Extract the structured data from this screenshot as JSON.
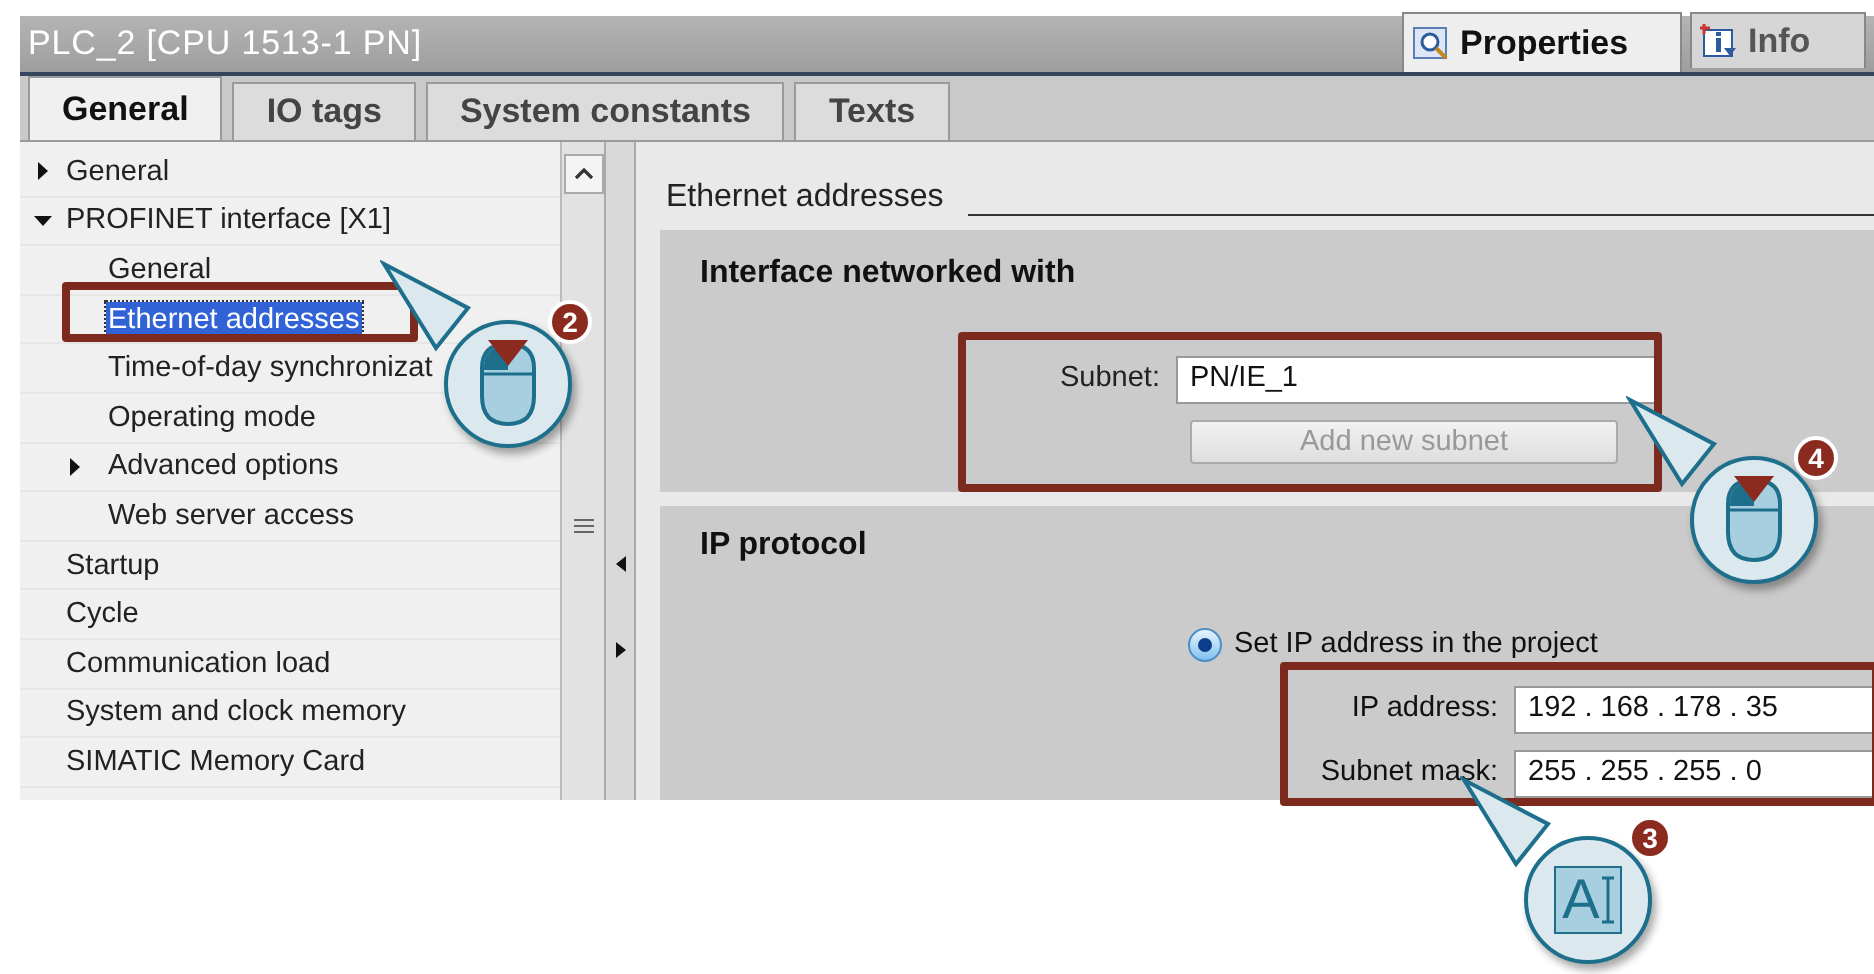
{
  "window": {
    "title": "PLC_2 [CPU 1513-1 PN]"
  },
  "inspector_tabs": [
    {
      "label": "Properties",
      "selected": true,
      "kind": "properties"
    },
    {
      "label": "Info",
      "selected": false,
      "kind": "info"
    }
  ],
  "tabs": [
    {
      "label": "General",
      "selected": true
    },
    {
      "label": "IO tags",
      "selected": false
    },
    {
      "label": "System constants",
      "selected": false
    },
    {
      "label": "Texts",
      "selected": false
    }
  ],
  "tree": [
    {
      "label": "General",
      "expanded": false,
      "selected": false
    },
    {
      "label": "PROFINET interface [X1]",
      "expanded": true,
      "selected": false,
      "children": [
        {
          "label": "General",
          "selected": false
        },
        {
          "label": "Ethernet addresses",
          "selected": true
        },
        {
          "label": "Time-of-day synchronizat",
          "selected": false
        },
        {
          "label": "Operating mode",
          "selected": false
        },
        {
          "label": "Advanced options",
          "expanded": false,
          "selected": false
        },
        {
          "label": "Web server access",
          "selected": false
        }
      ]
    },
    {
      "label": "Startup",
      "selected": false
    },
    {
      "label": "Cycle",
      "selected": false
    },
    {
      "label": "Communication load",
      "selected": false
    },
    {
      "label": "System and clock memory",
      "selected": false
    },
    {
      "label": "SIMATIC Memory Card",
      "selected": false
    }
  ],
  "content": {
    "heading": "Ethernet addresses",
    "interface_section": {
      "title": "Interface networked with",
      "subnet_label": "Subnet:",
      "subnet_value": "PN/IE_1",
      "add_button": {
        "label": "Add new subnet",
        "disabled": true
      }
    },
    "ip_section": {
      "title": "IP protocol",
      "radio": {
        "label": "Set IP address in the project",
        "selected": true
      },
      "fields": [
        {
          "label": "IP address:",
          "value": "192 . 168 . 178 . 35"
        },
        {
          "label": "Subnet mask:",
          "value": "255 . 255 . 255 . 0"
        }
      ]
    }
  },
  "callouts": [
    {
      "number": "2",
      "kind": "mouse"
    },
    {
      "number": "4",
      "kind": "mouse"
    },
    {
      "number": "3",
      "kind": "text",
      "glyph": "A"
    }
  ]
}
